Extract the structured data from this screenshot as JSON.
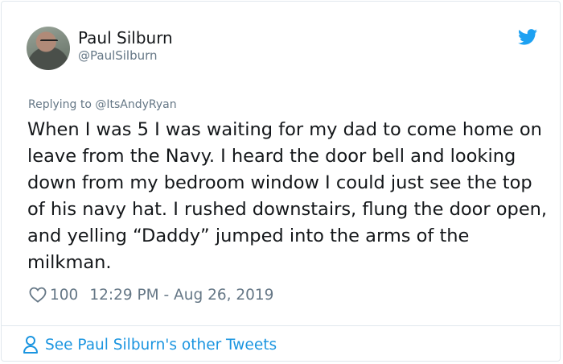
{
  "author": {
    "display_name": "Paul Silburn",
    "handle": "@PaulSilburn"
  },
  "reply": {
    "text": "Replying to @ItsAndyRyan"
  },
  "tweet": {
    "text": "When I was 5 I was waiting for my dad to come home on leave from the Navy. I heard the door bell and looking down from my bedroom window I could just see the top of his navy hat. I rushed downstairs, flung the door open, and yelling “Daddy” jumped into the arms of the milkman."
  },
  "meta": {
    "likes": "100",
    "timestamp": "12:29 PM - Aug 26, 2019"
  },
  "footer": {
    "link_text": "See Paul Silburn's other Tweets"
  },
  "icons": {
    "brand": "twitter-bird-icon",
    "like": "heart-icon",
    "profile": "person-icon"
  },
  "colors": {
    "brand": "#1da1f2",
    "link": "#1b95e0",
    "secondary_text": "#657786",
    "primary_text": "#14171a"
  }
}
